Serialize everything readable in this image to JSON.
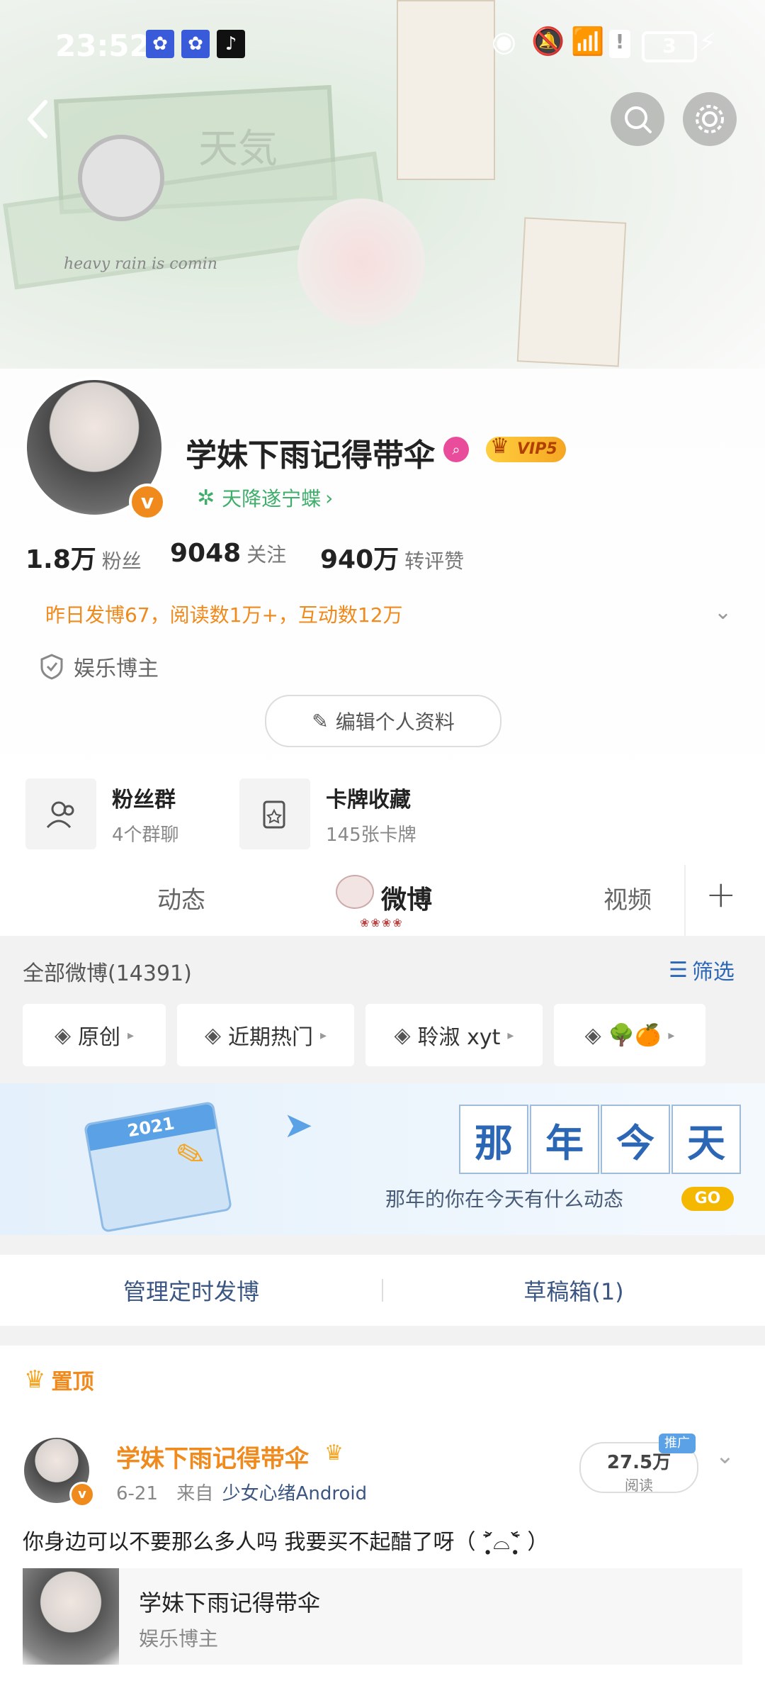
{
  "status_bar": {
    "time": "23:52",
    "battery": "3"
  },
  "banner": {
    "script_text": "heavy rain is comin",
    "deco_title": "天気"
  },
  "profile": {
    "name": "学妹下雨记得带伞",
    "vip": "VIP5",
    "subtitle": "天降遂宁蝶",
    "stats": [
      {
        "value": "1.8万",
        "label": "粉丝"
      },
      {
        "value": "9048",
        "label": "关注"
      },
      {
        "value": "940万",
        "label": "转评赞"
      }
    ],
    "summary": "昨日发博67，阅读数1万+，互动数12万",
    "tag": "娱乐博主",
    "edit_button": "编辑个人资料"
  },
  "tiles": [
    {
      "title": "粉丝群",
      "subtitle": "4个群聊"
    },
    {
      "title": "卡牌收藏",
      "subtitle": "145张卡牌"
    }
  ],
  "tabs": {
    "dynamic": "动态",
    "weibo": "微博",
    "weibo_deco": "❀❀❀❀",
    "video": "视频"
  },
  "weibo_list": {
    "count_label": "全部微博(14391)",
    "filter_label": "筛选",
    "chips": [
      "原创",
      "近期热门",
      "聆淑 xyt",
      "🌳🍊"
    ]
  },
  "promo": {
    "calendar_year": "2021",
    "chars": [
      "那",
      "年",
      "今",
      "天"
    ],
    "caption": "那年的你在今天有什么动态",
    "go": "GO"
  },
  "actions": {
    "schedule": "管理定时发博",
    "drafts": "草稿箱(1)"
  },
  "pinned_label": "置顶",
  "post": {
    "author": "学妹下雨记得带伞",
    "date": "6-21",
    "from_label": "来自",
    "source": "少女心绪Android",
    "reads": "27.5万",
    "reads_label": "阅读",
    "promo_badge": "推广",
    "text": "你身边可以不要那么多人吗 我要买不起醋了呀（ ˃̣̣̥᷄⌓˂̣̣̥᷅ ）",
    "card_name": "学妹下雨记得带伞",
    "card_tag": "娱乐博主"
  },
  "colors": {
    "orange": "#f08a1c",
    "green": "#3fae6a",
    "blue": "#2c67b5",
    "vip_gold": "#f5b224"
  }
}
